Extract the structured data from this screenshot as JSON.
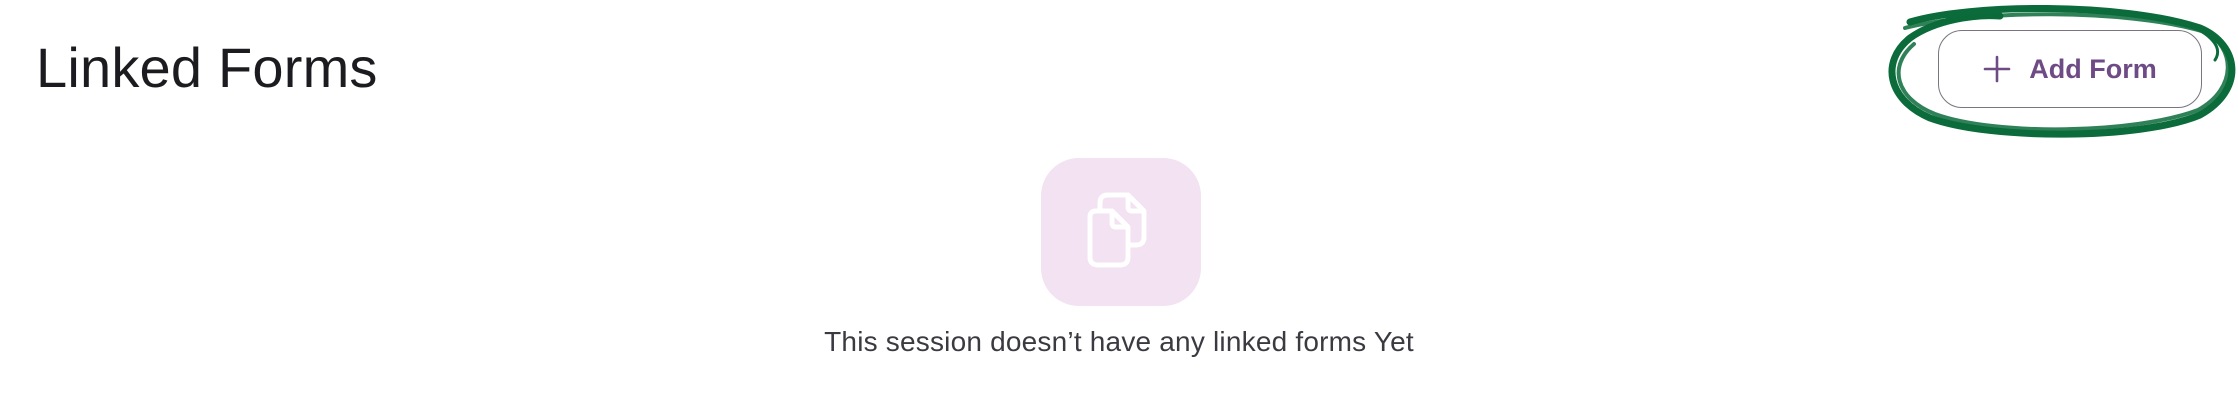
{
  "header": {
    "title": "Linked Forms",
    "add_button_label": "Add Form"
  },
  "empty_state": {
    "message": "This session doesn’t have any linked forms Yet"
  },
  "icons": {
    "add": "plus-icon",
    "empty": "documents-copy-icon"
  },
  "colors": {
    "accent": "#6e4b85",
    "icon_box": "#f2e2f2",
    "annotation": "#0b6b3a",
    "text": "#1c1b1f"
  }
}
